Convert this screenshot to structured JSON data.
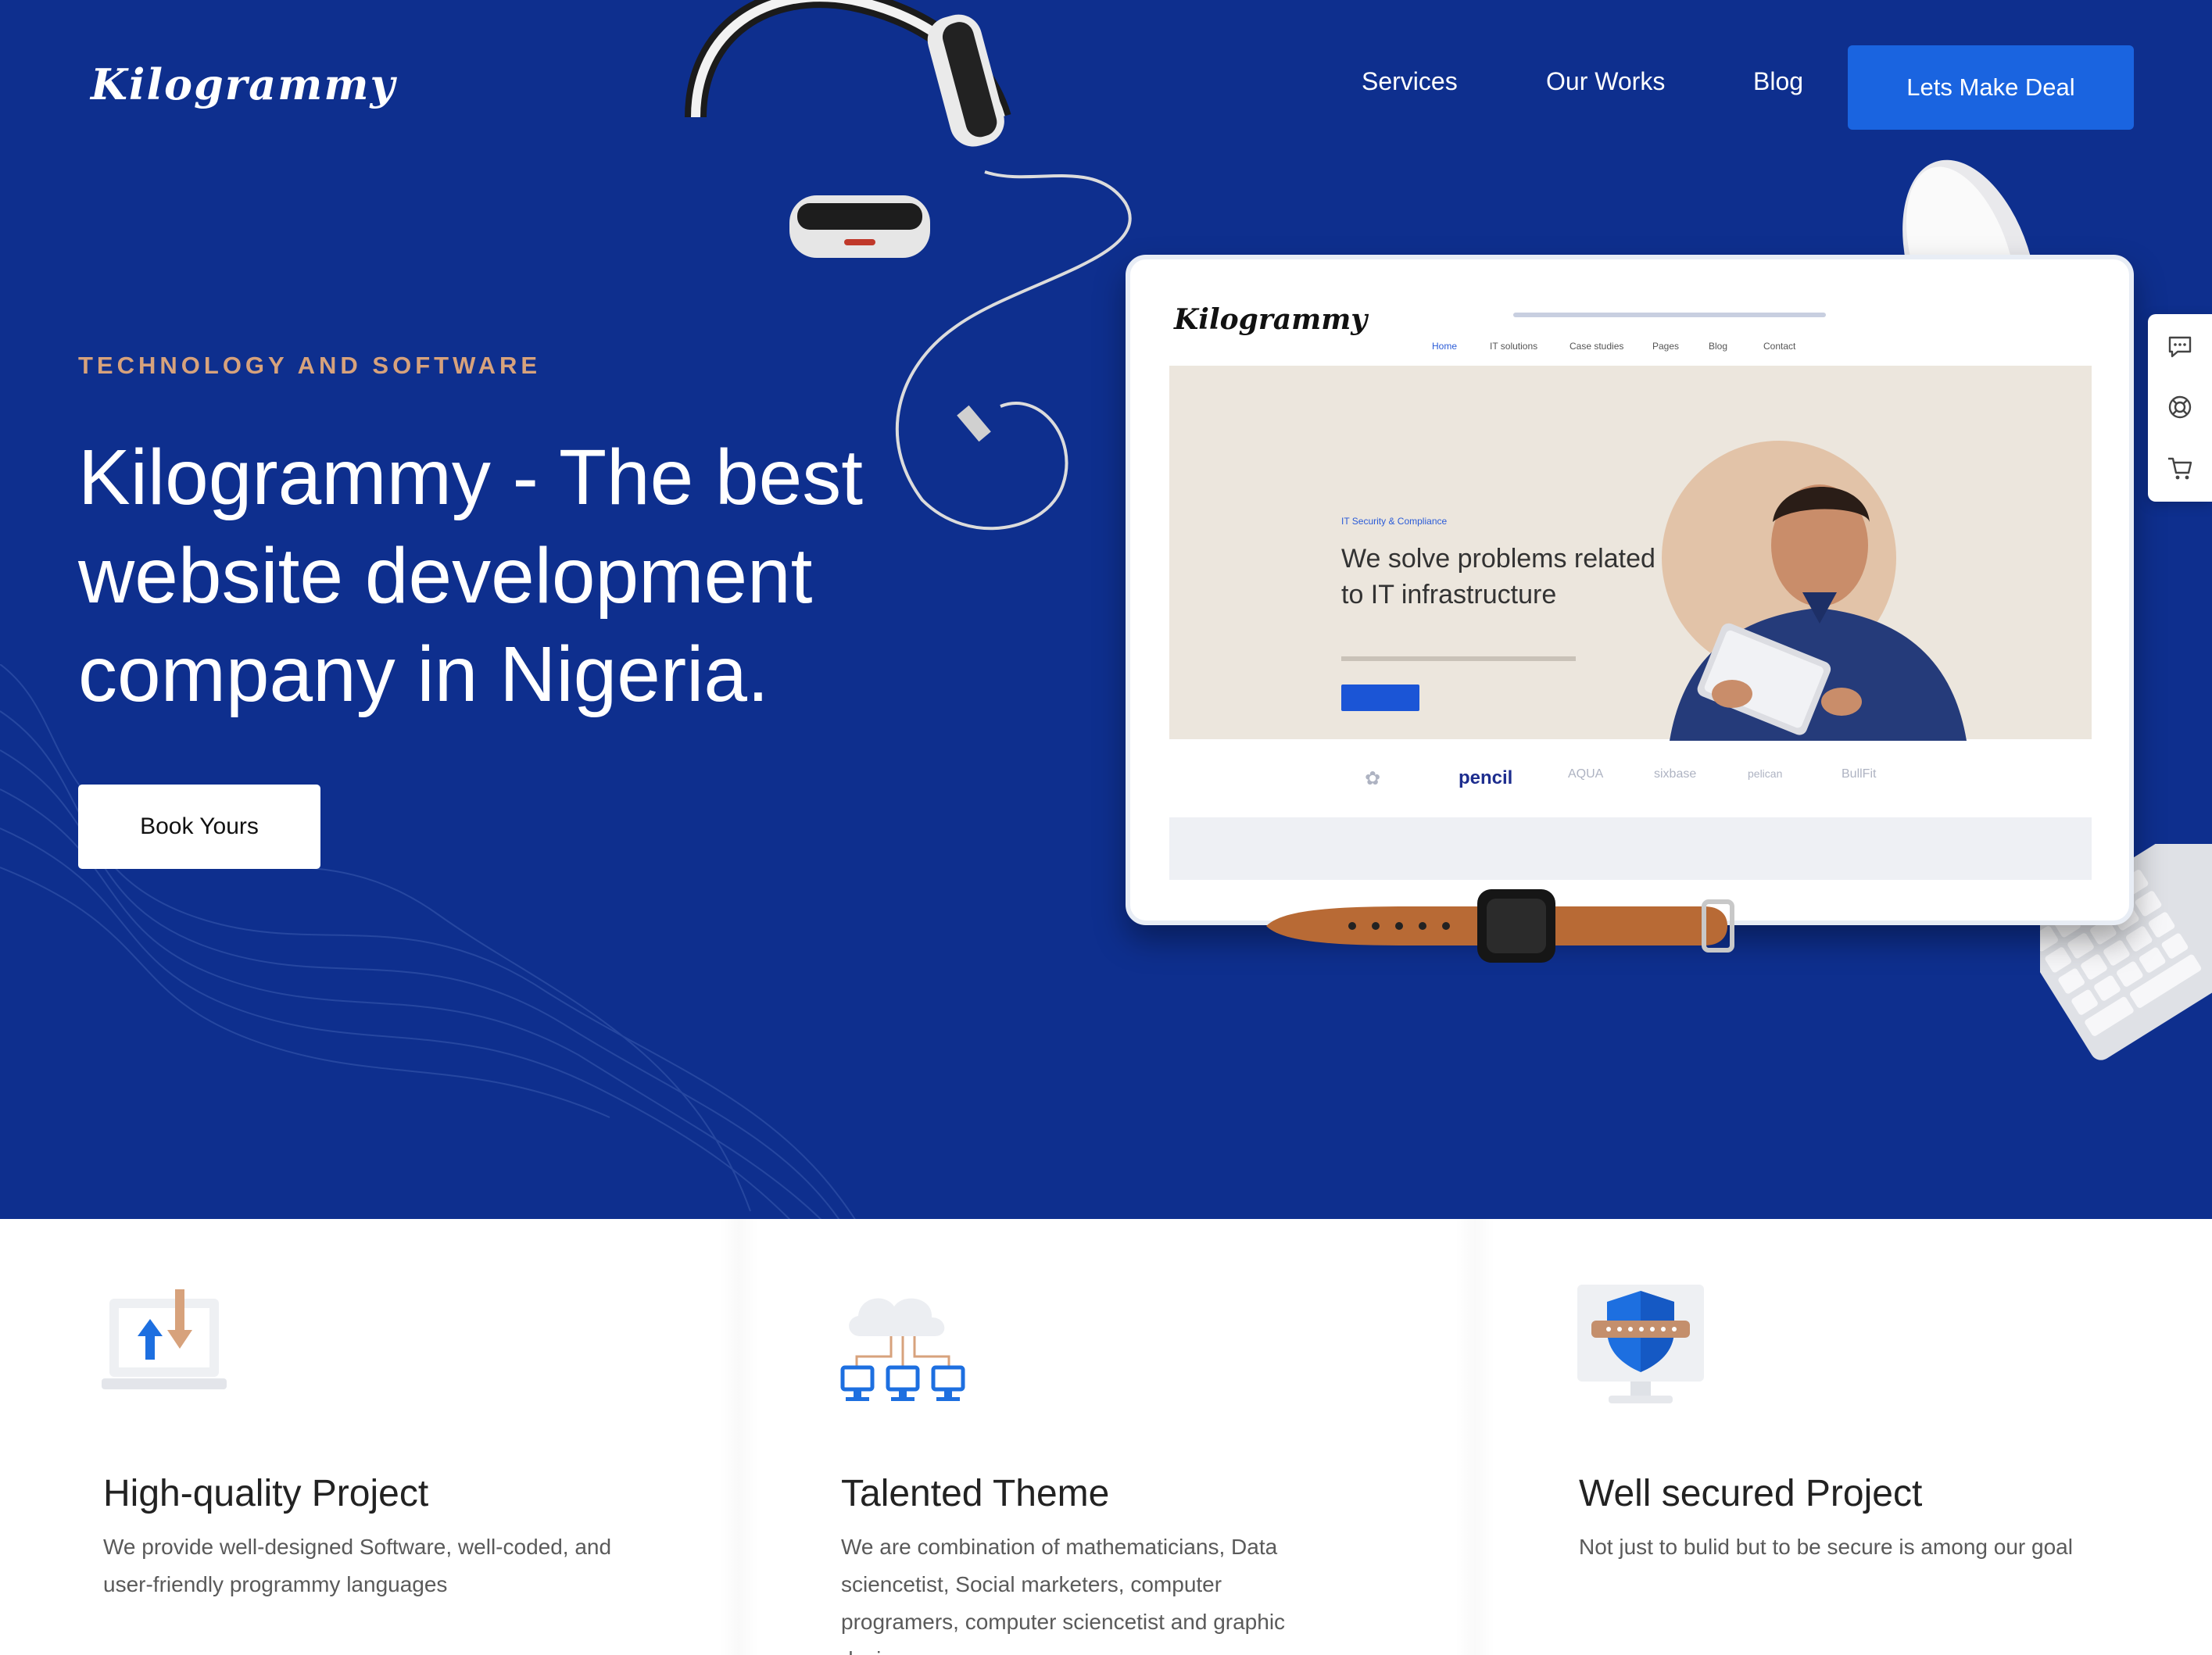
{
  "header": {
    "logo": "Kilogrammy",
    "nav": [
      "Services",
      "Our Works",
      "Blog"
    ],
    "cta_label": "Lets Make Deal"
  },
  "hero": {
    "eyebrow": "TECHNOLOGY AND SOFTWARE",
    "headline": "Kilogrammy - The best website development company in Nigeria.",
    "button_label": "Book Yours"
  },
  "tablet_screen": {
    "logo": "Kilogrammy",
    "menu": [
      "Home",
      "IT solutions",
      "Case studies",
      "Pages",
      "Blog",
      "Contact"
    ],
    "small_label": "IT Security & Compliance",
    "heading": "We solve problems related to IT infrastructure",
    "partner_logos": [
      "pencil",
      "AQUA",
      "sixbase",
      "pelican",
      "BullFit"
    ]
  },
  "sidebar": {
    "icons": [
      "sms-icon",
      "support-icon",
      "cart-icon"
    ]
  },
  "features": [
    {
      "icon": "laptop-transfer-icon",
      "title": "High-quality Project",
      "text": "We provide well-designed Software, well-coded, and user-friendly programmy languages"
    },
    {
      "icon": "cloud-network-icon",
      "title": "Talented Theme",
      "text": "We are combination of mathematicians, Data sciencetist, Social marketers, computer programers, computer sciencetist and graphic designers"
    },
    {
      "icon": "security-shield-icon",
      "title": "Well secured Project",
      "text": "Not just to bulid but to be secure is among our goal"
    }
  ],
  "colors": {
    "hero_bg": "#0e2f8e",
    "accent": "#1a64e0",
    "eyebrow": "#d7a27c"
  }
}
